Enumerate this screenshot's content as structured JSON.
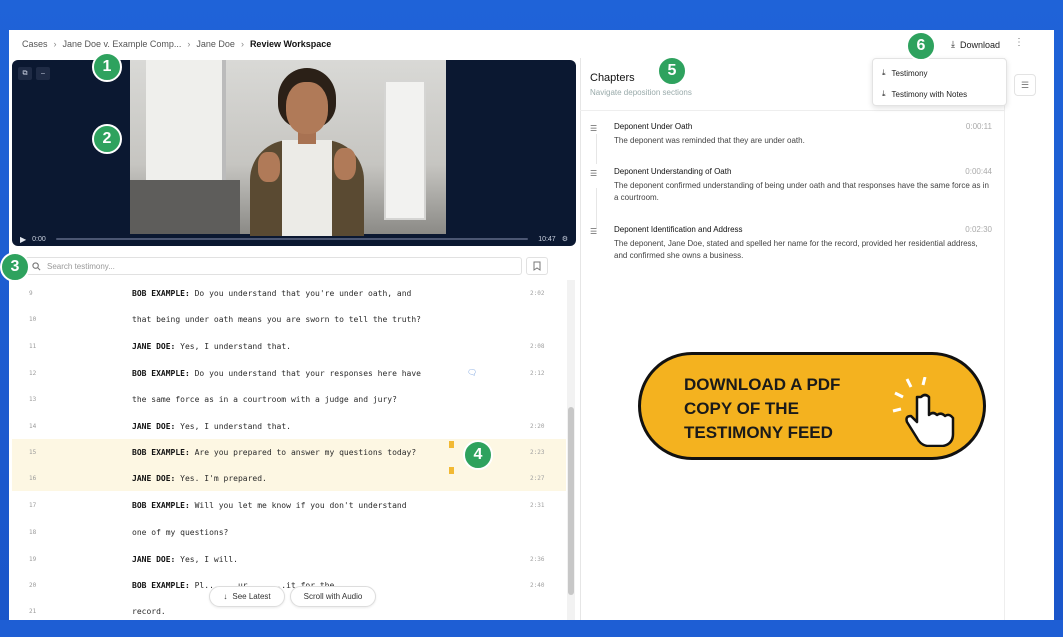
{
  "breadcrumbs": [
    "Cases",
    "Jane Doe v. Example Comp...",
    "Jane Doe",
    "Review Workspace"
  ],
  "download": {
    "label": "Download",
    "menu": [
      "Testimony",
      "Testimony with Notes"
    ]
  },
  "video": {
    "current_time": "0:00",
    "duration": "10:47"
  },
  "search": {
    "placeholder": "Search testimony..."
  },
  "transcript": [
    {
      "num": "9",
      "speaker": "BOB EXAMPLE:",
      "text": " Do you understand that you're under oath, and",
      "time": "2:02"
    },
    {
      "num": "10",
      "speaker": "",
      "text": "that being under oath means you are sworn to tell the truth?",
      "time": ""
    },
    {
      "num": "11",
      "speaker": "JANE DOE:",
      "text": " Yes, I understand that.",
      "time": "2:08"
    },
    {
      "num": "12",
      "speaker": "BOB EXAMPLE:",
      "text": " Do you understand that your responses here have",
      "time": "2:12"
    },
    {
      "num": "13",
      "speaker": "",
      "text": "the same force as in a courtroom with a judge and jury?",
      "time": ""
    },
    {
      "num": "14",
      "speaker": "JANE DOE:",
      "text": " Yes, I understand that.",
      "time": "2:20"
    },
    {
      "num": "15",
      "speaker": "BOB EXAMPLE:",
      "text": " Are you prepared to answer my questions today?",
      "time": "2:23"
    },
    {
      "num": "16",
      "speaker": "JANE DOE:",
      "text": " Yes. I'm prepared.",
      "time": "2:27"
    },
    {
      "num": "17",
      "speaker": "BOB EXAMPLE:",
      "text": " Will you let me know if you don't understand",
      "time": "2:31"
    },
    {
      "num": "18",
      "speaker": "",
      "text": "one of my questions?",
      "time": ""
    },
    {
      "num": "19",
      "speaker": "JANE DOE:",
      "text": " Yes, I will.",
      "time": "2:36"
    },
    {
      "num": "20",
      "speaker": "BOB EXAMPLE:",
      "text": " Pl...  ...ur ...  ...it for the",
      "time": "2:40"
    },
    {
      "num": "21",
      "speaker": "",
      "text": "record.",
      "time": ""
    }
  ],
  "pills": {
    "latest": "See Latest",
    "scroll_audio": "Scroll with Audio"
  },
  "chapters": {
    "title": "Chapters",
    "subtitle": "Navigate deposition sections",
    "items": [
      {
        "name": "Deponent Under Oath",
        "time": "0:00:11",
        "desc": "The deponent was reminded that they are under oath."
      },
      {
        "name": "Deponent Understanding of Oath",
        "time": "0:00:44",
        "desc": "The deponent confirmed understanding of being under oath and that responses have the same force as in a courtroom."
      },
      {
        "name": "Deponent Identification and Address",
        "time": "0:02:30",
        "desc": "The deponent, Jane Doe, stated and spelled her name for the record, provided her residential address, and confirmed she owns a business."
      }
    ]
  },
  "markers": [
    "1",
    "2",
    "3",
    "4",
    "5",
    "6"
  ],
  "cta": {
    "text": "DOWNLOAD A PDF COPY OF THE TESTIMONY FEED"
  },
  "colors": {
    "marker": "#2ea25e",
    "cta": "#f4b21f",
    "highlight": "#fdf7e3",
    "bookmark": "#f2b933"
  }
}
